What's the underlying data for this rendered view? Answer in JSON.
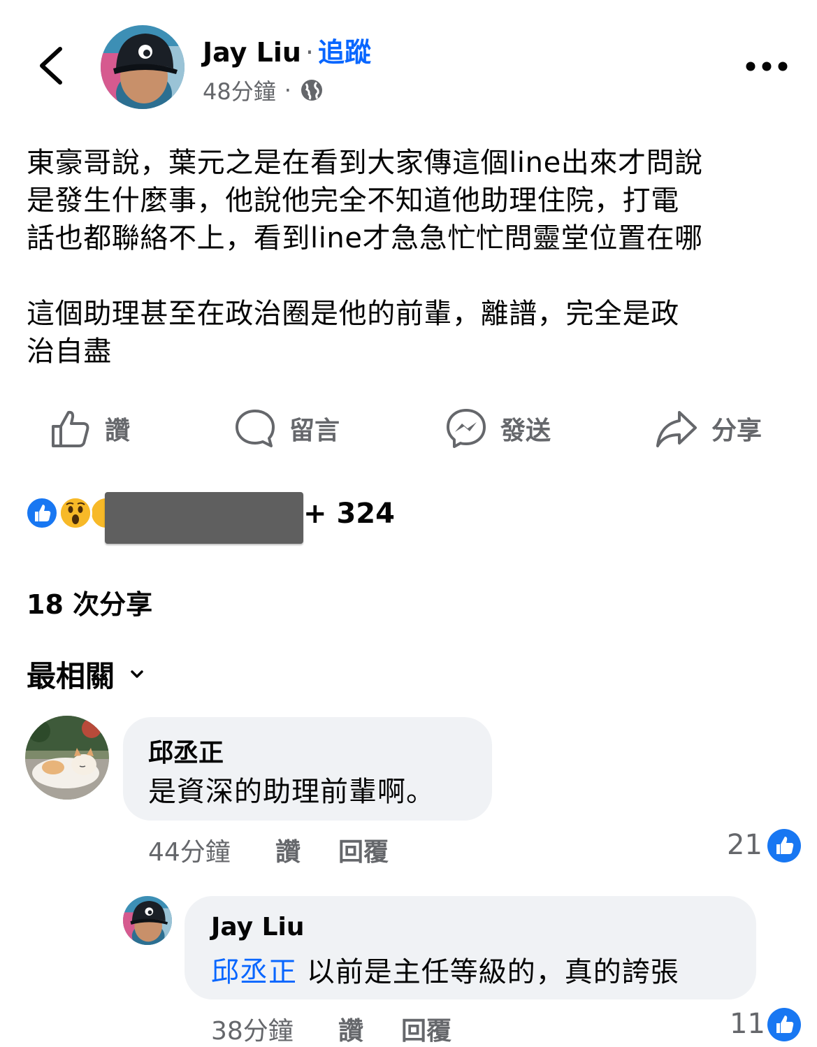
{
  "header": {
    "author": "Jay Liu",
    "separator": "·",
    "follow_label": "追蹤",
    "time": "48分鐘",
    "meta_separator": "·",
    "privacy_icon": "globe-icon",
    "back_icon": "chevron-left-icon",
    "more_icon": "more-dots-icon"
  },
  "post": {
    "lines": [
      "東豪哥說，葉元之是在看到大家傳這個line出來才問說",
      "是發生什麼事，他說他完全不知道他助理住院，打電",
      "話也都聯絡不上，看到line才急急忙忙問靈堂位置在哪",
      "這個助理甚至在政治圈是他的前輩，離譜，完全是政",
      "治自盡"
    ]
  },
  "actions": {
    "like": "讚",
    "comment": "留言",
    "send": "發送",
    "share": "分享"
  },
  "reactions": {
    "icons": [
      "like-reaction-icon",
      "wow-reaction-icon"
    ],
    "count": "+ 324"
  },
  "shares": "18 次分享",
  "sort": {
    "label": "最相關",
    "icon": "chevron-down-icon"
  },
  "comments": [
    {
      "author": "邱丞正",
      "text": "是資深的助理前輩啊。",
      "time": "44分鐘",
      "like_label": "讚",
      "reply_label": "回覆",
      "like_count": "21"
    },
    {
      "author": "Jay Liu",
      "mention": "邱丞正",
      "text": " 以前是主任等級的，真的誇張",
      "time": "38分鐘",
      "like_label": "讚",
      "reply_label": "回覆",
      "like_count": "11"
    }
  ],
  "colors": {
    "accent": "#0866ff",
    "like_blue": "#1877f2",
    "secondary_text": "#65676b",
    "bubble_bg": "#f0f2f5"
  }
}
